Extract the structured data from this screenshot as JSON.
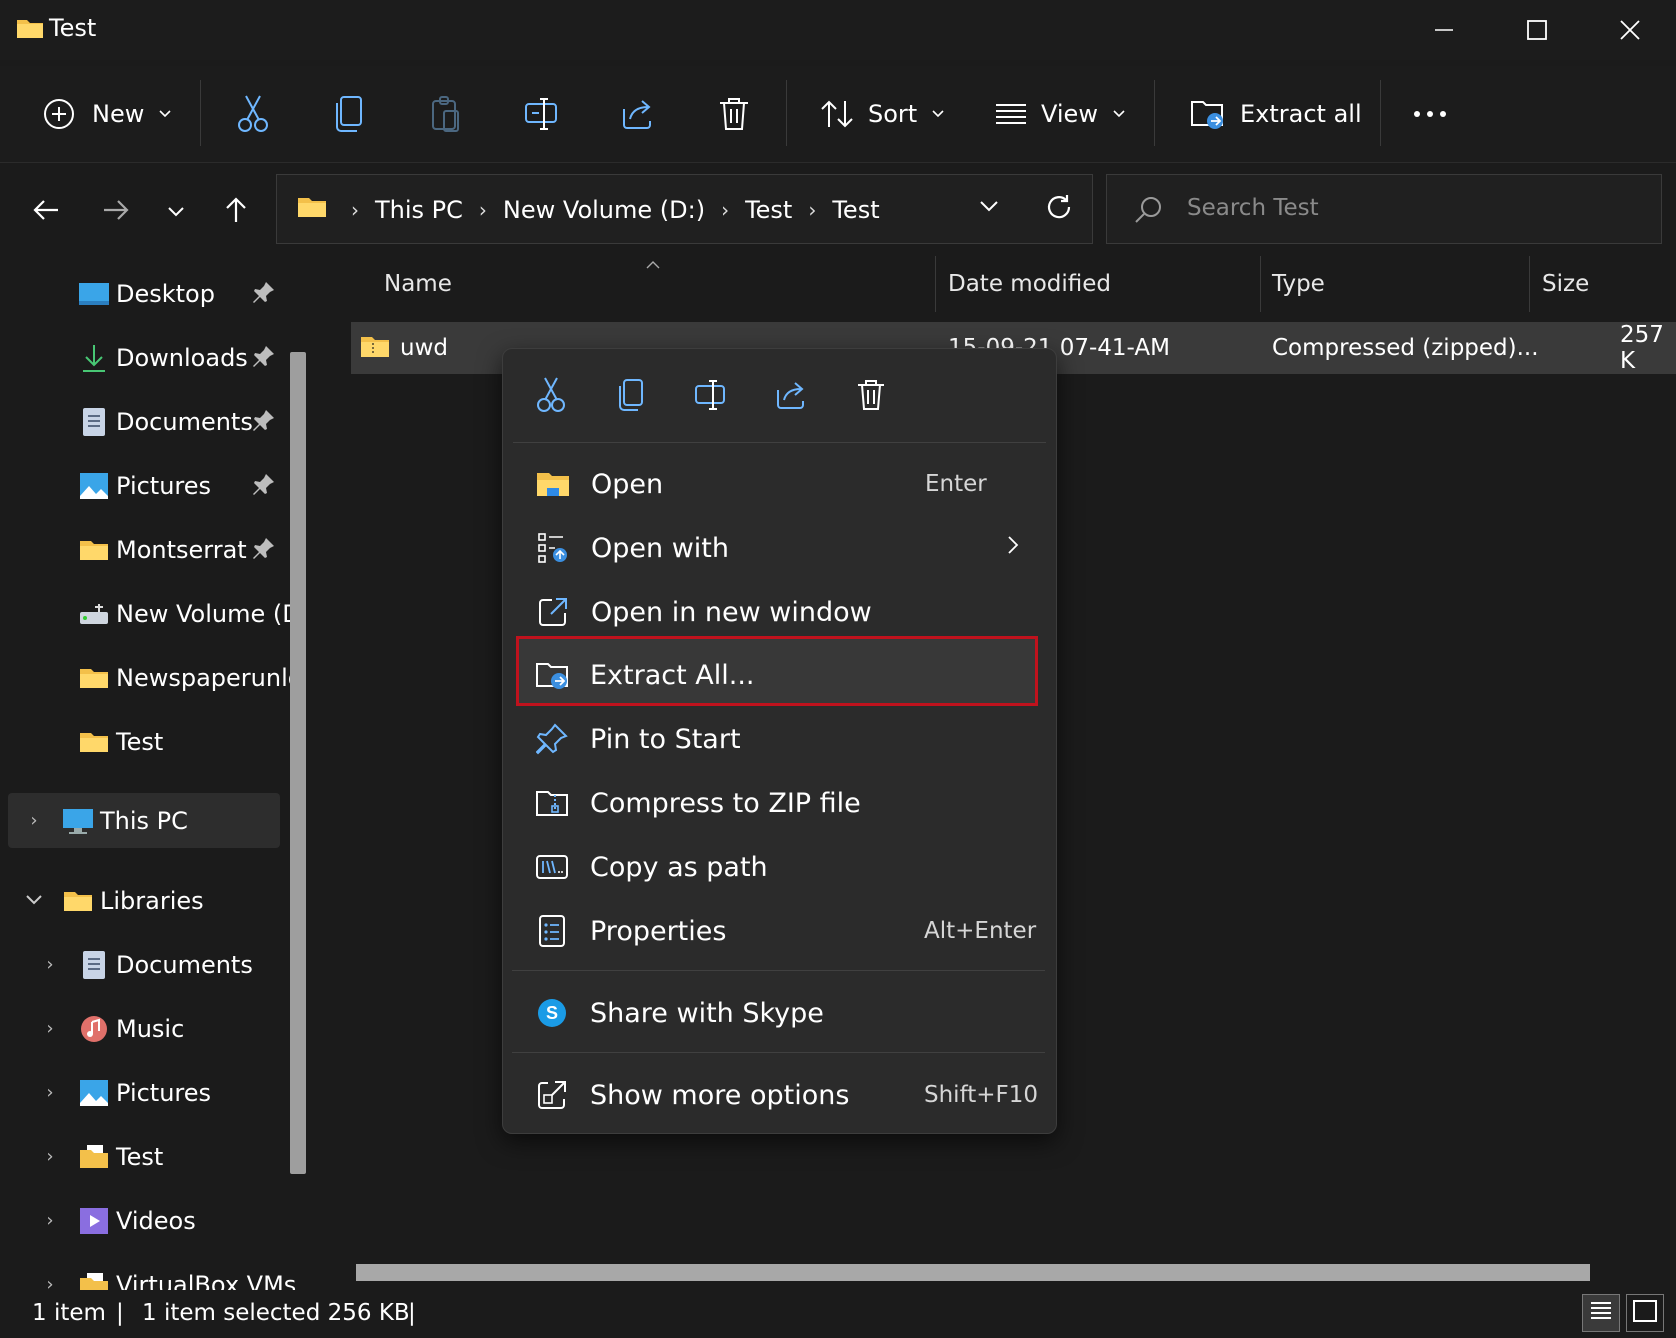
{
  "window": {
    "title": "Test",
    "controls": [
      "minimize",
      "maximize",
      "close"
    ]
  },
  "toolbar": {
    "new_label": "New",
    "sort_label": "Sort",
    "view_label": "View",
    "extract_all_label": "Extract all",
    "icons": [
      "cut-icon",
      "copy-icon",
      "paste-icon",
      "rename-icon",
      "share-icon",
      "delete-icon",
      "more-icon"
    ]
  },
  "address": {
    "crumbs": [
      "This PC",
      "New Volume (D:)",
      "Test",
      "Test"
    ]
  },
  "search": {
    "placeholder": "Search Test"
  },
  "sidebar": {
    "quick_access": [
      {
        "label": "Desktop",
        "icon": "desktop-icon",
        "pinned": true
      },
      {
        "label": "Downloads",
        "icon": "download-icon",
        "pinned": true
      },
      {
        "label": "Documents",
        "icon": "document-icon",
        "pinned": true
      },
      {
        "label": "Pictures",
        "icon": "pictures-icon",
        "pinned": true
      },
      {
        "label": "Montserrat",
        "icon": "folder-icon",
        "pinned": true
      },
      {
        "label": "New Volume (D",
        "icon": "drive-icon",
        "pinned": false
      },
      {
        "label": "Newspaperunlo",
        "icon": "folder-icon",
        "pinned": false
      },
      {
        "label": "Test",
        "icon": "folder-icon",
        "pinned": false
      }
    ],
    "this_pc": "This PC",
    "libraries": "Libraries",
    "library_items": [
      {
        "label": "Documents",
        "icon": "document-icon"
      },
      {
        "label": "Music",
        "icon": "music-icon"
      },
      {
        "label": "Pictures",
        "icon": "pictures-icon"
      },
      {
        "label": "Test",
        "icon": "folder-icon"
      },
      {
        "label": "Videos",
        "icon": "video-icon"
      },
      {
        "label": "VirtualBox VMs",
        "icon": "folder-icon"
      }
    ]
  },
  "columns": {
    "name": "Name",
    "date": "Date modified",
    "type": "Type",
    "size": "Size"
  },
  "file": {
    "name": "uwd",
    "date": "15-09-21 07-41-AM",
    "type": "Compressed (zipped)...",
    "size": "257 K"
  },
  "context_menu": {
    "quick_actions": [
      "cut-icon",
      "copy-icon",
      "rename-icon",
      "share-icon",
      "delete-icon"
    ],
    "items": [
      {
        "label": "Open",
        "shortcut": "Enter"
      },
      {
        "label": "Open with",
        "shortcut": ""
      },
      {
        "label": "Open in new window",
        "shortcut": ""
      },
      {
        "label": "Extract All...",
        "shortcut": ""
      },
      {
        "label": "Pin to Start",
        "shortcut": ""
      },
      {
        "label": "Compress to ZIP file",
        "shortcut": ""
      },
      {
        "label": "Copy as path",
        "shortcut": ""
      },
      {
        "label": "Properties",
        "shortcut": "Alt+Enter"
      },
      {
        "label": "Share with Skype",
        "shortcut": ""
      },
      {
        "label": "Show more options",
        "shortcut": "Shift+F10"
      }
    ]
  },
  "status": {
    "count": "1 item",
    "selected": "1 item selected  256 KB"
  },
  "colors": {
    "background": "#1b1b1b",
    "menu_bg": "#2b2b2b",
    "highlight_border": "#c0121d",
    "accent_blue": "#5aa0e6",
    "folder_yellow": "#f3c04a"
  }
}
